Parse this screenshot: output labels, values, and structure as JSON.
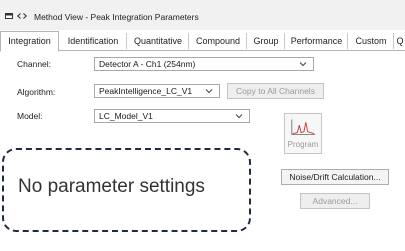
{
  "window": {
    "title": "Method View - Peak Integration Parameters"
  },
  "tabs": [
    "Integration",
    "Identification",
    "Quantitative",
    "Compound",
    "Group",
    "Performance",
    "Custom",
    "Q"
  ],
  "form": {
    "channel_label": "Channel:",
    "channel_value": "Detector A - Ch1 (254nm)",
    "algorithm_label": "Algorithm:",
    "algorithm_value": "PeakIntelligence_LC_V1",
    "copy_button": "Copy to All Channels",
    "model_label": "Model:",
    "model_value": "LC_Model_V1"
  },
  "program_button": "Program",
  "noise_button": "Noise/Drift Calculation...",
  "advanced_button": "Advanced...",
  "notice": "No parameter settings"
}
